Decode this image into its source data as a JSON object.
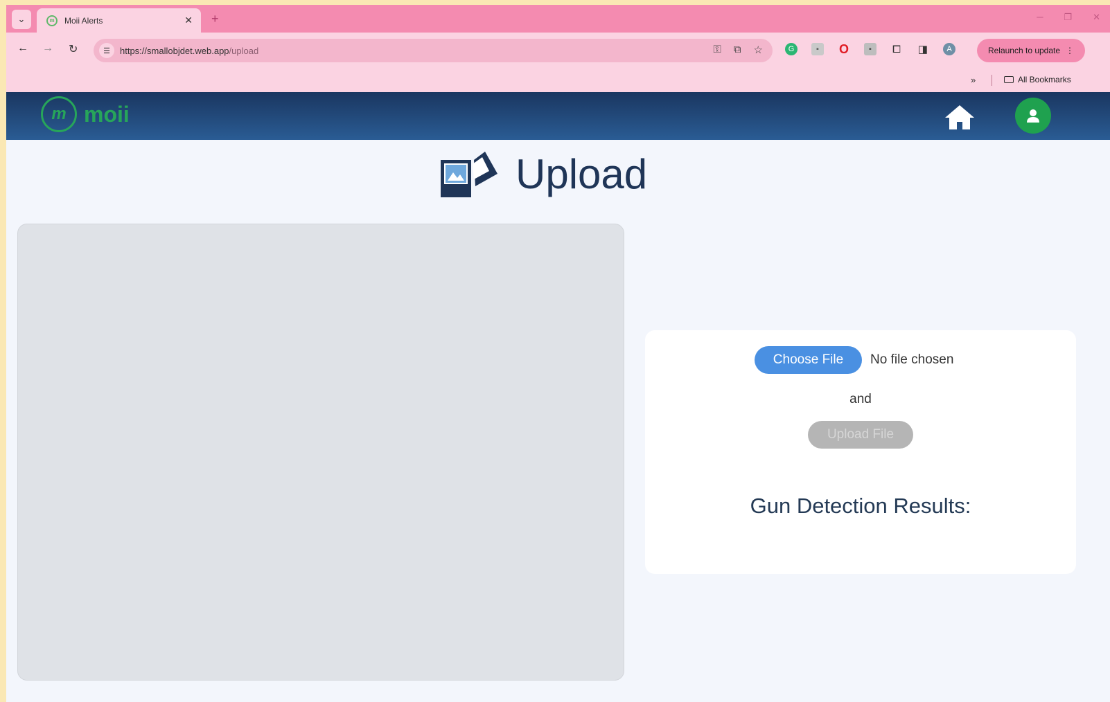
{
  "browser": {
    "tab_title": "Moii Alerts",
    "tab_close": "✕",
    "new_tab": "+",
    "url_base": "https://smallobjdet.web.app",
    "url_path": "/upload",
    "relaunch_label": "Relaunch to update",
    "bookmarks_more": "»",
    "all_bookmarks_label": "All Bookmarks"
  },
  "app": {
    "logo_text": "moii",
    "page_title": "Upload"
  },
  "upload_card": {
    "choose_file_label": "Choose File",
    "file_status": "No file chosen",
    "and_text": "and",
    "upload_button_label": "Upload File",
    "results_heading": "Gun Detection Results:"
  },
  "colors": {
    "tab_strip": "#f48bb0",
    "toolbar": "#fbd3e2",
    "header_top": "#1a3660",
    "header_bottom": "#2a5c94",
    "brand_green": "#27a55a",
    "choose_button": "#4a90e2",
    "upload_button_disabled": "#b5b5b5"
  }
}
